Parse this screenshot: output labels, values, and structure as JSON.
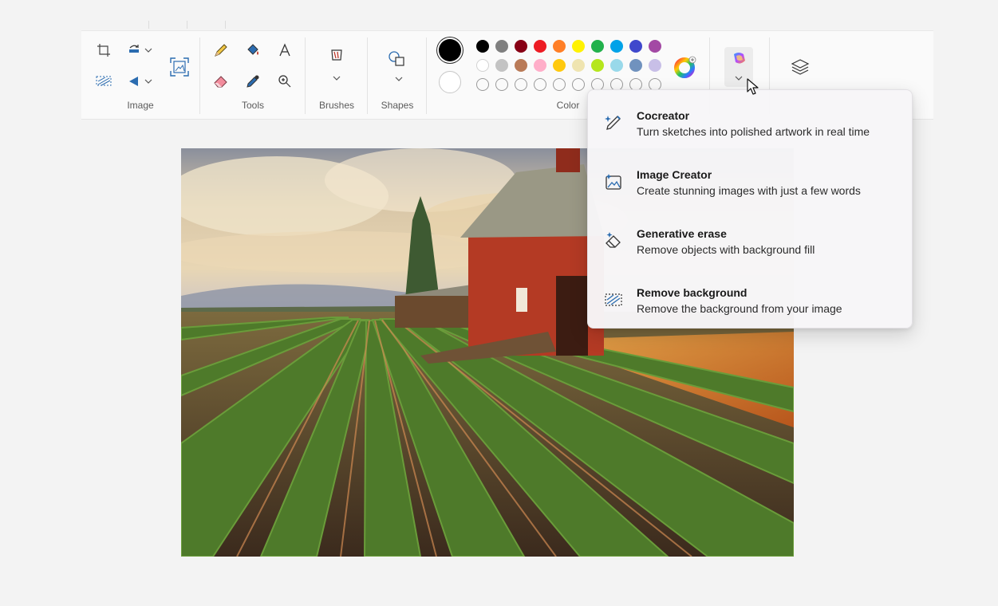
{
  "toolbar": {
    "groups": {
      "image": "Image",
      "tools": "Tools",
      "brushes": "Brushes",
      "shapes": "Shapes",
      "color": "Color"
    },
    "icons": {
      "image": [
        "crop-icon",
        "rotate-icon",
        "select-icon",
        "flip-icon",
        "resize-icon"
      ],
      "tools": [
        "pencil-icon",
        "fill-bucket-icon",
        "text-icon",
        "eraser-icon",
        "color-picker-icon",
        "magnifier-icon"
      ],
      "extra": [
        "brush-icon",
        "shapes-icon",
        "copilot-icon",
        "layers-icon",
        "color-wheel-icon"
      ]
    },
    "colors": {
      "primary": "#000000",
      "secondary": "#ffffff",
      "row1": [
        "#000000",
        "#7f7f7f",
        "#880015",
        "#ed1c24",
        "#ff7f27",
        "#fff200",
        "#22b14c",
        "#00a2e8",
        "#3f48cc",
        "#a349a4"
      ],
      "row2": [
        "#ffffff",
        "#c3c3c3",
        "#b97a57",
        "#ffaec9",
        "#ffc90e",
        "#efe4b0",
        "#b5e61d",
        "#99d9ea",
        "#7092be",
        "#c8bfe7"
      ]
    }
  },
  "copilot_menu": {
    "items": [
      {
        "title": "Cocreator",
        "desc": "Turn sketches into polished artwork in real time",
        "icon": "paintbrush-sparkle-icon"
      },
      {
        "title": "Image Creator",
        "desc": "Create stunning images with just a few words",
        "icon": "image-sparkle-icon"
      },
      {
        "title": "Generative erase",
        "desc": "Remove objects with background fill",
        "icon": "eraser-sparkle-icon"
      },
      {
        "title": "Remove background",
        "desc": "Remove the background from your image",
        "icon": "remove-background-icon"
      }
    ]
  }
}
